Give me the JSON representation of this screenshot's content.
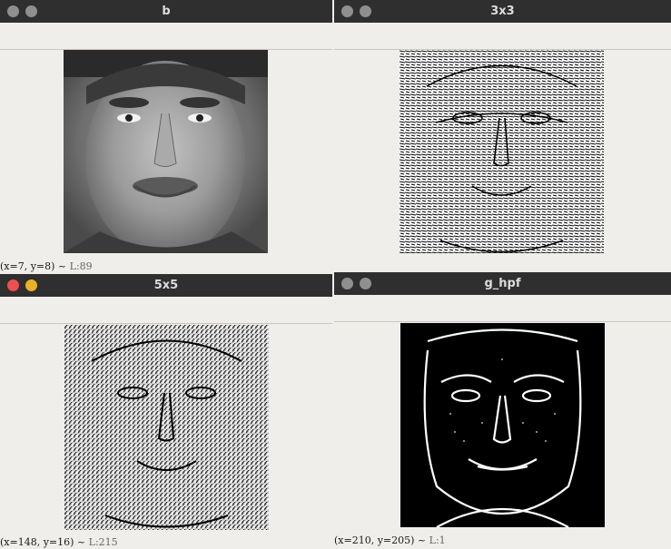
{
  "windows": {
    "b": {
      "title": "b",
      "status_coords": "(x=7, y=8) ~",
      "status_luma": "L:89"
    },
    "w3x3": {
      "title": "3x3"
    },
    "w5x5": {
      "title": "5x5",
      "status_coords": "(x=148, y=16) ~",
      "status_luma": "L:215"
    },
    "g_hpf": {
      "title": "g_hpf",
      "status_coords": "(x=210, y=205) ~",
      "status_luma": "L:1"
    }
  },
  "colors": {
    "titlebar": "#2f2f2f",
    "close": "#ec4f4f",
    "minimize": "#e9b127",
    "inactive_button": "#8f8f8f",
    "background": "#f0eeea"
  }
}
